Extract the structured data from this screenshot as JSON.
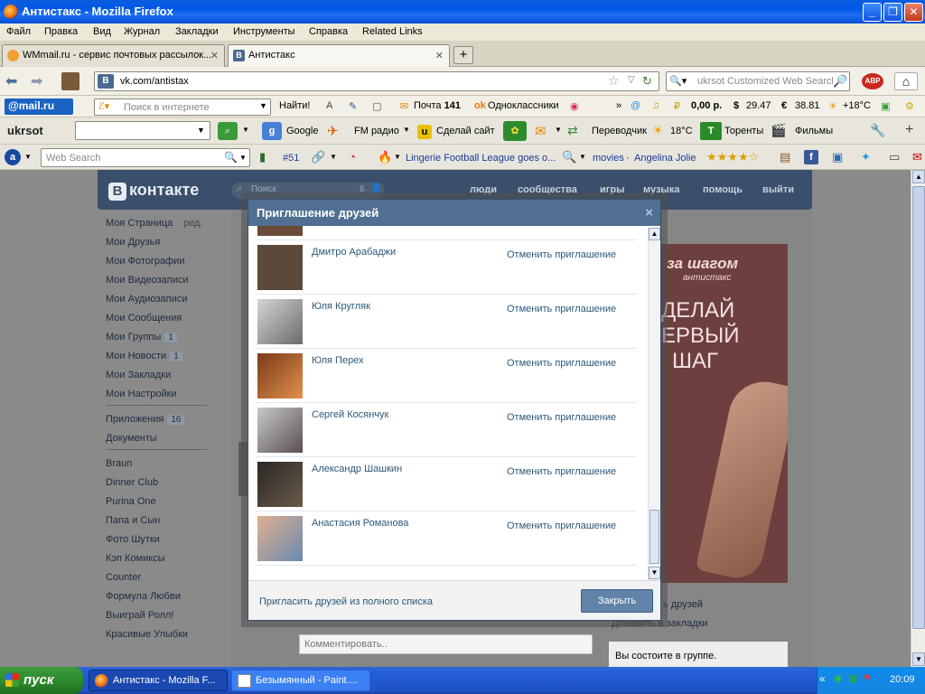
{
  "window": {
    "title": "Антистакс - Mozilla Firefox"
  },
  "menu": [
    "Файл",
    "Правка",
    "Вид",
    "Журнал",
    "Закладки",
    "Инструменты",
    "Справка",
    "Related Links"
  ],
  "tabs": [
    {
      "label": "WMmail.ru - сервис почтовых рассылок..."
    },
    {
      "label": "Антистакс"
    }
  ],
  "nav": {
    "url": "vk.com/antistax",
    "search_placeholder": "ukrsot Customized Web Search"
  },
  "toolbar_mail": {
    "logo": "@mail.ru",
    "search_placeholder": "Поиск в интернете",
    "find": "Найти!",
    "mail": "Почта",
    "mail_count": "141",
    "ok": "Одноклассники",
    "money": "0,00 р.",
    "usd": "29.47",
    "eur": "38.81",
    "temp": "+18°C"
  },
  "toolbar_ukrsot": {
    "logo": "ukrsot",
    "google": "Google",
    "fm": "FM радио",
    "site": "Сделай сайт",
    "translator": "Переводчик",
    "temp": "18°C",
    "torrents": "Торенты",
    "films": "Фильмы"
  },
  "toolbar_ask": {
    "search_placeholder": "Web Search",
    "rank": "#51",
    "news": "Lingerie Football League goes o...",
    "movies": "movies",
    "dot": "·",
    "actress": "Angelina Jolie"
  },
  "vk": {
    "logo": "контакте",
    "logo_b": "В",
    "search_placeholder": "Поиск",
    "search_count": "6",
    "nav": [
      "люди",
      "сообщества",
      "игры",
      "музыка",
      "помощь",
      "выйти"
    ],
    "left": {
      "my_page": "Моя Страница",
      "edit": "ред.",
      "friends": "Мои Друзья",
      "photos": "Мои Фотографии",
      "videos": "Мои Видеозаписи",
      "audio": "Мои Аудиозаписи",
      "messages": "Мои Сообщения",
      "groups": "Мои Группы",
      "groups_count": "1",
      "news": "Мои Новости",
      "news_count": "1",
      "bookmarks": "Мои Закладки",
      "settings": "Мои Настройки",
      "apps": "Приложения",
      "apps_count": "16",
      "docs": "Документы",
      "links": [
        "Braun",
        "Dinner Club",
        "Purina One",
        "Папа и Сын",
        "Фото Шутки",
        "Кэп Комиксы",
        "Counter",
        "Формула Любви",
        "Выиграй Ролл!",
        "Красивые Улыбки"
      ]
    },
    "comment_placeholder": "Комментировать..",
    "right": {
      "invite_friends": "ь друзей",
      "add_bookmarks": "Добавить в закладки",
      "member": "Вы состоите в группе."
    },
    "ad": {
      "line1": "за шагом",
      "brand": "антистакс",
      "line2": "ДЕЛАЙ",
      "line3": "ЕРВЫЙ",
      "line4": "ШАГ"
    }
  },
  "modal": {
    "title": "Приглашение друзей",
    "close_x": "×",
    "cancel_label": "Отменить приглашение",
    "people": [
      {
        "name": "Дмитро Арабаджи",
        "avatar_color": "#5b4a3c"
      },
      {
        "name": "Юля Кругляк",
        "avatar_color": "#8b8b8b"
      },
      {
        "name": "Юля Перех",
        "avatar_color": "#b5602c"
      },
      {
        "name": "Сергей Косянчук",
        "avatar_color": "#a6a6a6"
      },
      {
        "name": "Александр Шашкин",
        "avatar_color": "#3d3a36"
      },
      {
        "name": "Анастасия Романова",
        "avatar_color": "#8aa3c0"
      }
    ],
    "invite_all": "Пригласить друзей из полного списка",
    "close_button": "Закрыть"
  },
  "taskbar": {
    "start": "пуск",
    "apps": [
      {
        "label": "Антистакс - Mozilla F..."
      },
      {
        "label": "Безымянный - Paint...."
      }
    ],
    "clock": "20:09"
  },
  "colors": {
    "vk_header": "#394f6b",
    "modal_header": "#506f92",
    "link": "#2b587a",
    "xp_taskbar": "#245edb"
  }
}
